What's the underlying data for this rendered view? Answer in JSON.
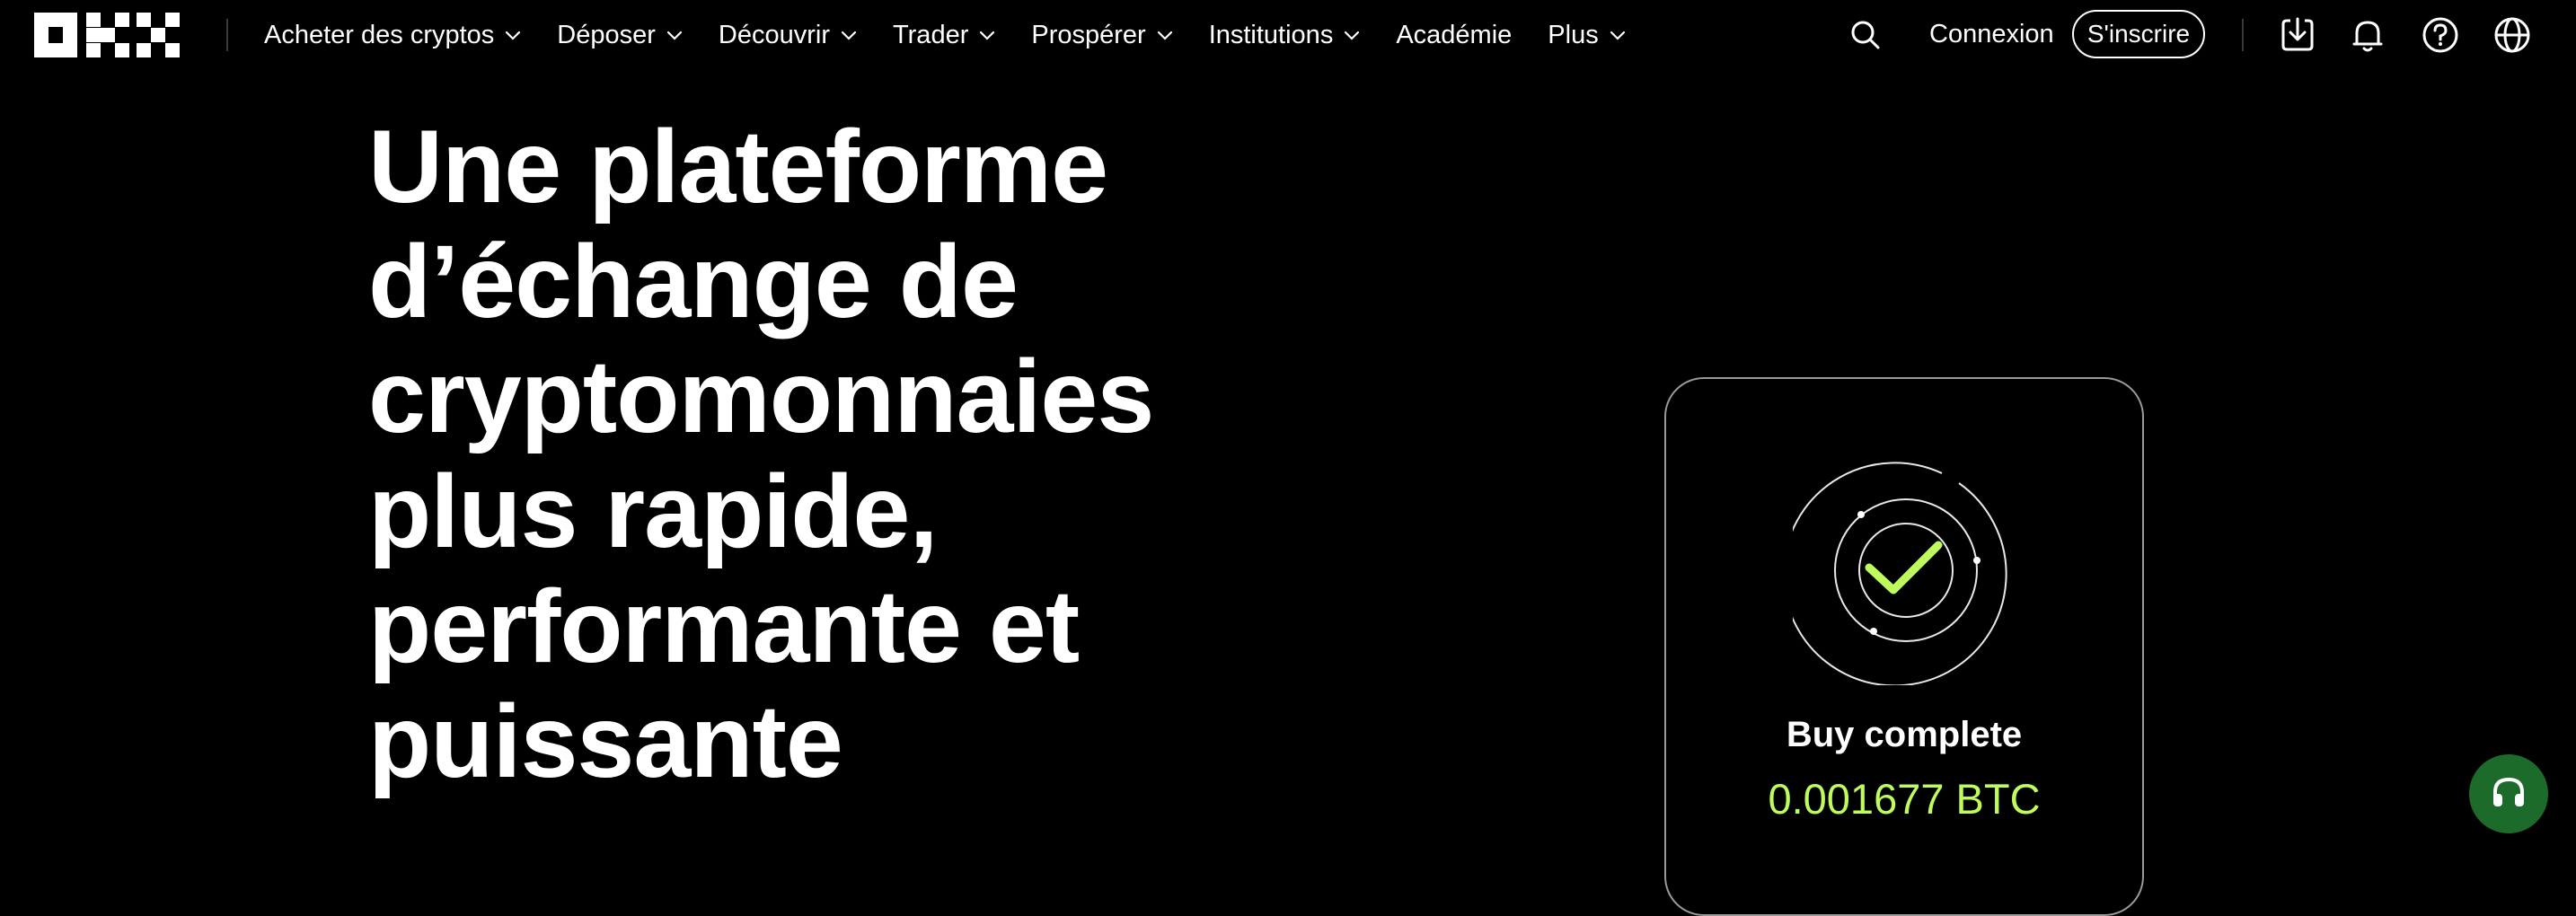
{
  "brand": {
    "logo_text": "OKX"
  },
  "nav": {
    "menu": [
      {
        "label": "Acheter des cryptos",
        "has_dropdown": true
      },
      {
        "label": "Déposer",
        "has_dropdown": true
      },
      {
        "label": "Découvrir",
        "has_dropdown": true
      },
      {
        "label": "Trader",
        "has_dropdown": true
      },
      {
        "label": "Prospérer",
        "has_dropdown": true
      },
      {
        "label": "Institutions",
        "has_dropdown": true
      },
      {
        "label": "Académie",
        "has_dropdown": false
      },
      {
        "label": "Plus",
        "has_dropdown": true
      }
    ],
    "login_label": "Connexion",
    "signup_label": "S'inscrire",
    "icons": [
      "search-icon",
      "download-icon",
      "bell-icon",
      "help-icon",
      "globe-icon"
    ]
  },
  "hero": {
    "lines": [
      "Une plateforme",
      "d’échange de",
      "cryptomonnaies",
      "plus rapide,",
      "performante et",
      "puissante"
    ]
  },
  "card": {
    "title": "Buy complete",
    "amount": "0.001677 BTC",
    "icon": "check-icon"
  },
  "colors": {
    "background": "#000000",
    "accent": "#bdfc5c",
    "support_button": "#1d6b2a"
  }
}
